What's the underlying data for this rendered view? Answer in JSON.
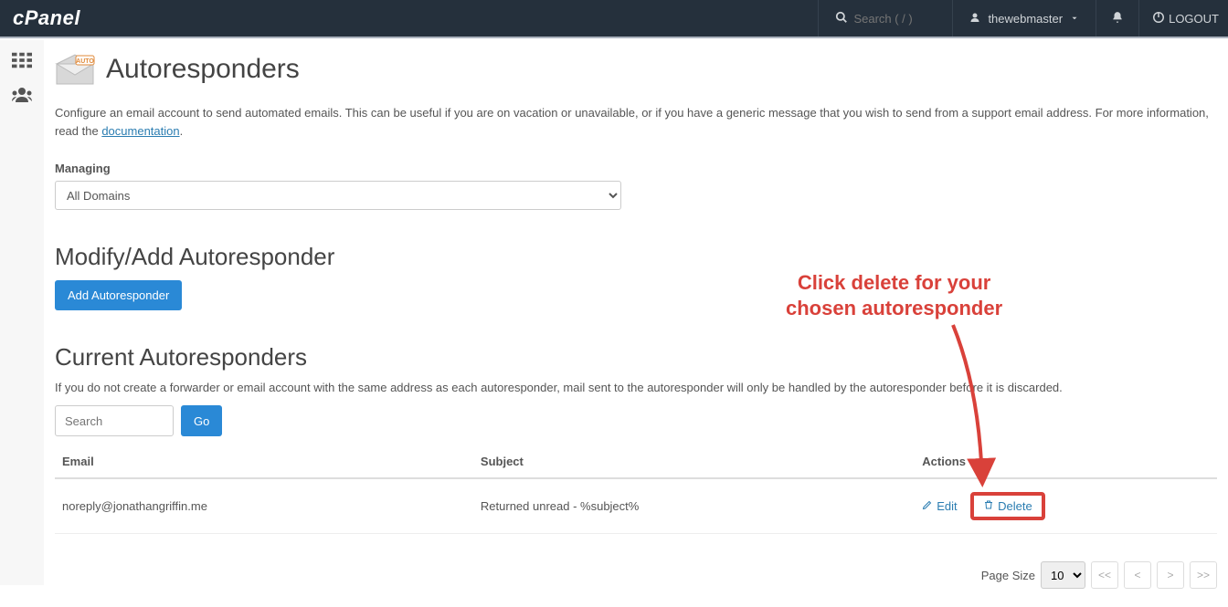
{
  "header": {
    "logo_text": "cPanel",
    "search_placeholder": "Search ( / )",
    "username": "thewebmaster",
    "logout_label": "LOGOUT"
  },
  "page": {
    "title": "Autoresponders",
    "desc_part1": "Configure an email account to send automated emails. This can be useful if you are on vacation or unavailable, or if you have a generic message that you wish to send from a support email address. For more information, read the ",
    "doc_link_label": "documentation",
    "desc_part2": ".",
    "managing_label": "Managing",
    "domain_selected": "All Domains",
    "modify_heading": "Modify/Add Autoresponder",
    "add_button_label": "Add Autoresponder",
    "current_heading": "Current Autoresponders",
    "current_note": "If you do not create a forwarder or email account with the same address as each autoresponder, mail sent to the autoresponder will only be handled by the autoresponder before it is discarded.",
    "search_placeholder": "Search",
    "go_label": "Go",
    "columns": {
      "email": "Email",
      "subject": "Subject",
      "actions": "Actions"
    },
    "edit_label": "Edit",
    "delete_label": "Delete",
    "rows": [
      {
        "email": "noreply@jonathangriffin.me",
        "subject": "Returned unread - %subject%"
      }
    ],
    "page_size_label": "Page Size",
    "page_size_value": "10",
    "pager": {
      "first": "<<",
      "prev": "<",
      "next": ">",
      "last": ">>"
    }
  },
  "annotation": {
    "line1": "Click delete for your",
    "line2": "chosen autoresponder"
  }
}
